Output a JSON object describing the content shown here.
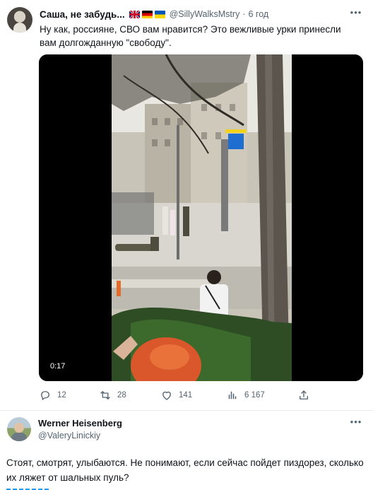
{
  "tweet": {
    "display_name": "Саша, не забудь...",
    "handle": "@SillyWalksMstry",
    "separator": "·",
    "time": "6 год",
    "text": "Ну как, россияне, СВО вам нравится? Это вежливые урки принесли вам долгожданную \"свободу\".",
    "flags": [
      "uk-flag",
      "germany-flag",
      "ukraine-flag"
    ],
    "more_label": "•••",
    "video": {
      "duration": "0:17"
    },
    "actions": {
      "replies": "12",
      "retweets": "28",
      "likes": "141",
      "views": "6 167"
    }
  },
  "reply": {
    "display_name": "Werner Heisenberg",
    "handle": "@ValeryLinickiy",
    "more_label": "•••",
    "text": "Стоят, смотрят, улыбаются. Не понимают, если сейчас пойдет пиздорез, сколько их ляжет от шальных пуль?"
  },
  "colors": {
    "text_primary": "#0f1419",
    "text_secondary": "#536471",
    "divider": "#e7ebee",
    "link": "#1d9bf0"
  }
}
